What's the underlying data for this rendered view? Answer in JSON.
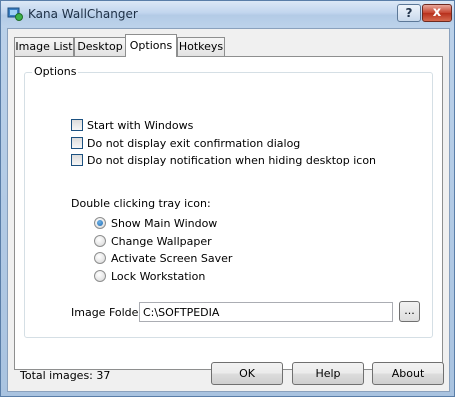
{
  "window": {
    "title": "Kana WallChanger",
    "help_symbol": "?",
    "close_symbol": "x"
  },
  "tabs": [
    {
      "label": "Image List",
      "active": false
    },
    {
      "label": "Desktop",
      "active": false
    },
    {
      "label": "Options",
      "active": true
    },
    {
      "label": "Hotkeys",
      "active": false
    }
  ],
  "options": {
    "group_label": "Options",
    "checkboxes": [
      {
        "label": "Start with Windows",
        "checked": false
      },
      {
        "label": "Do not display exit confirmation dialog",
        "checked": false
      },
      {
        "label": "Do not display notification when hiding desktop icon",
        "checked": false
      }
    ],
    "tray_label": "Double clicking tray icon:",
    "radios": [
      {
        "label": "Show Main Window",
        "checked": true
      },
      {
        "label": "Change Wallpaper",
        "checked": false
      },
      {
        "label": "Activate Screen Saver",
        "checked": false
      },
      {
        "label": "Lock Workstation",
        "checked": false
      }
    ],
    "folder_label": "Image Folder:",
    "folder_value": "C:\\SOFTPEDIA",
    "browse_label": "..."
  },
  "status": {
    "total_images": "Total images: 37"
  },
  "buttons": {
    "ok": "OK",
    "help": "Help",
    "about": "About"
  },
  "icons": {
    "app": "kana-app-icon",
    "help": "help-icon",
    "close": "close-icon"
  },
  "colors": {
    "title_bar": "#bcd2ea",
    "close_button": "#c6442f",
    "selected_radio": "#1f6bb3"
  }
}
